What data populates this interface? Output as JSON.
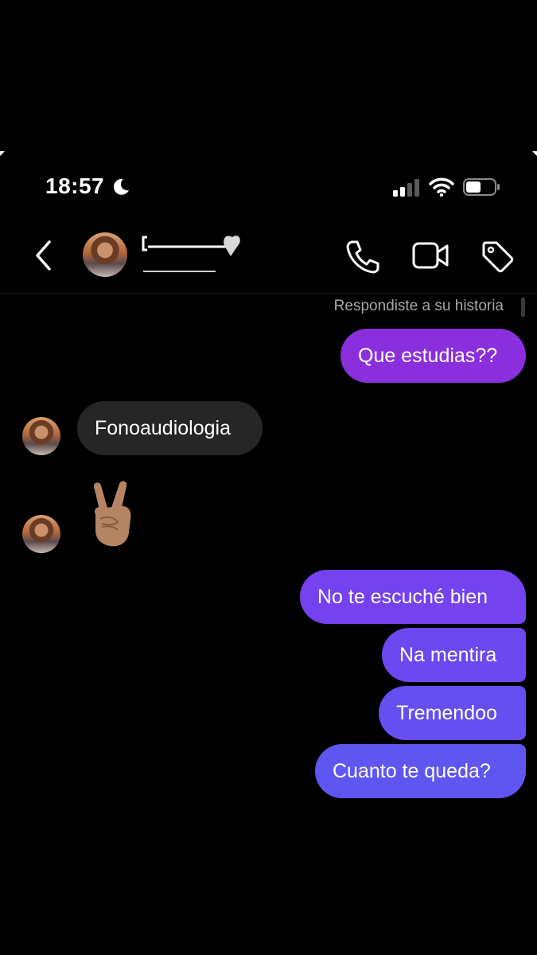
{
  "status_bar": {
    "time": "18:57",
    "icons": [
      "moon-icon",
      "cellular-signal-icon",
      "wifi-icon",
      "battery-icon"
    ]
  },
  "header": {
    "icons": [
      "back-chevron-icon",
      "phone-icon",
      "video-camera-icon",
      "tag-icon"
    ]
  },
  "conversation": {
    "story_reply_note": "Respondiste a su historia",
    "messages": [
      {
        "sender": "me",
        "text": "Que estudias??"
      },
      {
        "sender": "them",
        "text": "Fonoaudiologia"
      },
      {
        "sender": "them",
        "emoji": "victory-hand-icon"
      },
      {
        "sender": "me",
        "text": "No te escuché bien"
      },
      {
        "sender": "me",
        "text": "Na mentira"
      },
      {
        "sender": "me",
        "text": "Tremendoo"
      },
      {
        "sender": "me",
        "text": "Cuanto te queda?"
      }
    ]
  },
  "colors": {
    "background": "#000000",
    "incoming_bubble": "#262626",
    "outgoing_gradient_top": "#8a2fdd",
    "outgoing_gradient_bottom": "#5f55f0"
  }
}
